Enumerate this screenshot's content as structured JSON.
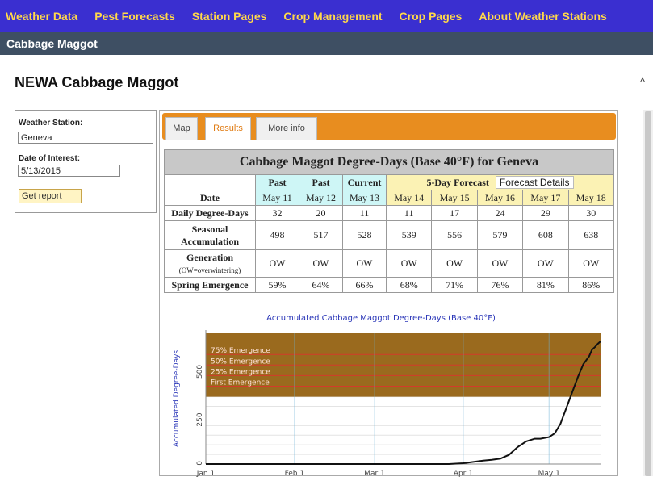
{
  "nav": {
    "items": [
      "Weather Data",
      "Pest Forecasts",
      "Station Pages",
      "Crop Management",
      "Crop Pages",
      "About Weather Stations"
    ]
  },
  "subbar": {
    "title": "Cabbage Maggot"
  },
  "page": {
    "title": "NEWA Cabbage Maggot"
  },
  "form": {
    "station_label": "Weather Station:",
    "station_value": "Geneva",
    "date_label": "Date of Interest:",
    "date_value": "5/13/2015",
    "button_label": "Get report"
  },
  "tabs": [
    {
      "label": "Map",
      "active": false
    },
    {
      "label": "Results",
      "active": true
    },
    {
      "label": "More info",
      "active": false
    }
  ],
  "table": {
    "title": "Cabbage Maggot Degree-Days (Base 40°F) for Geneva",
    "headers": {
      "past1": "Past",
      "past2": "Past",
      "current": "Current",
      "forecast": "5-Day Forecast",
      "forecast_details": "Forecast Details"
    },
    "date_label": "Date",
    "dates": [
      "May 11",
      "May 12",
      "May 13",
      "May 14",
      "May 15",
      "May 16",
      "May 17",
      "May 18"
    ],
    "daily_label": "Daily Degree-Days",
    "daily": [
      "32",
      "20",
      "11",
      "11",
      "17",
      "24",
      "29",
      "30"
    ],
    "seasonal_label": "Seasonal Accumulation",
    "seasonal": [
      "498",
      "517",
      "528",
      "539",
      "556",
      "579",
      "608",
      "638"
    ],
    "generation_label": "Generation",
    "generation_sub": "(OW=overwintering)",
    "generation": [
      "OW",
      "OW",
      "OW",
      "OW",
      "OW",
      "OW",
      "OW",
      "OW"
    ],
    "spring_label": "Spring Emergence",
    "spring": [
      "59%",
      "64%",
      "66%",
      "68%",
      "71%",
      "76%",
      "81%",
      "86%"
    ]
  },
  "colors": {
    "nav_bg": "#3a2fd0",
    "nav_text": "#ffd84a",
    "tab_bar": "#e88d1f",
    "emergence_band": "#9a6a1e",
    "threshold_line": "#d33b2a",
    "past_cell": "#cef6f6",
    "forecast_cell": "#fbf2b4"
  },
  "chart_data": {
    "type": "line",
    "title": "Accumulated Cabbage Maggot Degree-Days (Base 40°F)",
    "ylabel": "Accumulated Degree-Days",
    "xlabel": "",
    "x_ticks": [
      "Jan 1",
      "Feb 1",
      "Mar 1",
      "Apr 1",
      "May 1"
    ],
    "y_ticks": [
      0,
      250,
      500
    ],
    "ylim": [
      0,
      680
    ],
    "x_range_days": [
      0,
      138
    ],
    "grid": true,
    "thresholds": [
      {
        "label": "75% Emergence",
        "value": 570
      },
      {
        "label": "50% Emergence",
        "value": 515
      },
      {
        "label": "25% Emergence",
        "value": 460
      },
      {
        "label": "First Emergence",
        "value": 405
      }
    ],
    "band": {
      "from": 350,
      "to": 680
    },
    "series": [
      {
        "x_days": [
          0,
          20,
          40,
          60,
          85,
          90,
          94,
          97,
          100,
          103,
          106,
          109,
          112,
          115,
          117,
          120,
          122,
          124,
          126,
          128,
          130,
          132,
          134,
          135,
          136,
          137,
          138
        ],
        "values": [
          0,
          0,
          0,
          0,
          0,
          4,
          12,
          18,
          22,
          28,
          48,
          88,
          118,
          132,
          132,
          140,
          160,
          210,
          290,
          370,
          450,
          520,
          560,
          595,
          608,
          625,
          638
        ]
      }
    ]
  }
}
